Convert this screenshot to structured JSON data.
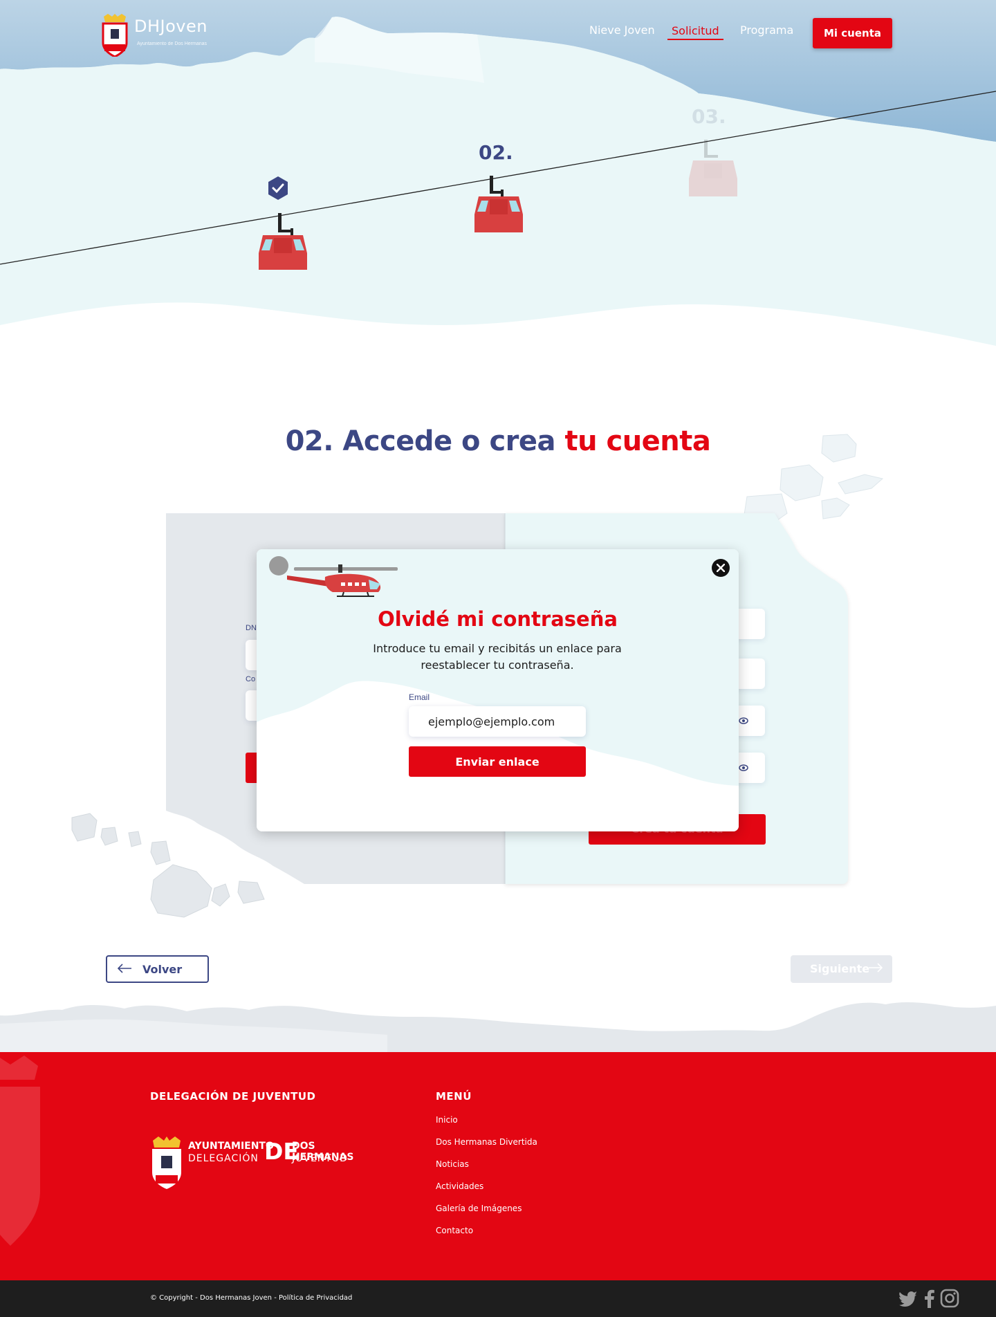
{
  "header": {
    "brand_name": "DHJoven",
    "brand_sub": "Ayuntamiento de Dos Hermanas",
    "nav": [
      {
        "label": "Nieve Joven"
      },
      {
        "label": "Solicitud"
      },
      {
        "label": "Programa"
      }
    ],
    "account_button": "Mi cuenta"
  },
  "steps": {
    "current": "02.",
    "next": "03."
  },
  "section": {
    "title_main": "02. Accede o crea",
    "title_accent": "tu cuenta"
  },
  "login_form": {
    "dni_label": "DN",
    "code_label": "Co"
  },
  "register_form": {
    "submit_label": "Crea tu cuenta"
  },
  "modal": {
    "title": "Olvidé mi contraseña",
    "text": "Introduce tu email y recibitás un enlace para reestablecer tu contraseña.",
    "email_label": "Email",
    "email_value": "ejemplo@ejemplo.com",
    "submit_label": "Enviar enlace"
  },
  "navigation": {
    "back_label": "Volver",
    "next_label": "Siguiente"
  },
  "footer": {
    "col1_heading": "DELEGACIÓN DE JUVENTUD",
    "col2_heading": "MENÚ",
    "logo": {
      "line1": "AYUNTAMIENTO",
      "line2": "DELEGACIÓN",
      "de": "DE",
      "line3": "DOS HERMANAS",
      "line4": "JUVENTUD"
    },
    "menu": [
      {
        "label": "Inicio"
      },
      {
        "label": "Dos Hermanas Divertida"
      },
      {
        "label": "Noticias"
      },
      {
        "label": "Actividades"
      },
      {
        "label": "Galería de Imágenes"
      },
      {
        "label": "Contacto"
      }
    ],
    "copyright": "© Copyright - Dos Hermanas Joven - Política de Privacidad",
    "social": [
      "twitter-icon",
      "facebook-icon",
      "instagram-icon"
    ]
  },
  "colors": {
    "brand_red": "#e30613",
    "brand_navy": "#3c4784",
    "sky": "#a9c9e0",
    "snow": "#eaf7f8"
  }
}
